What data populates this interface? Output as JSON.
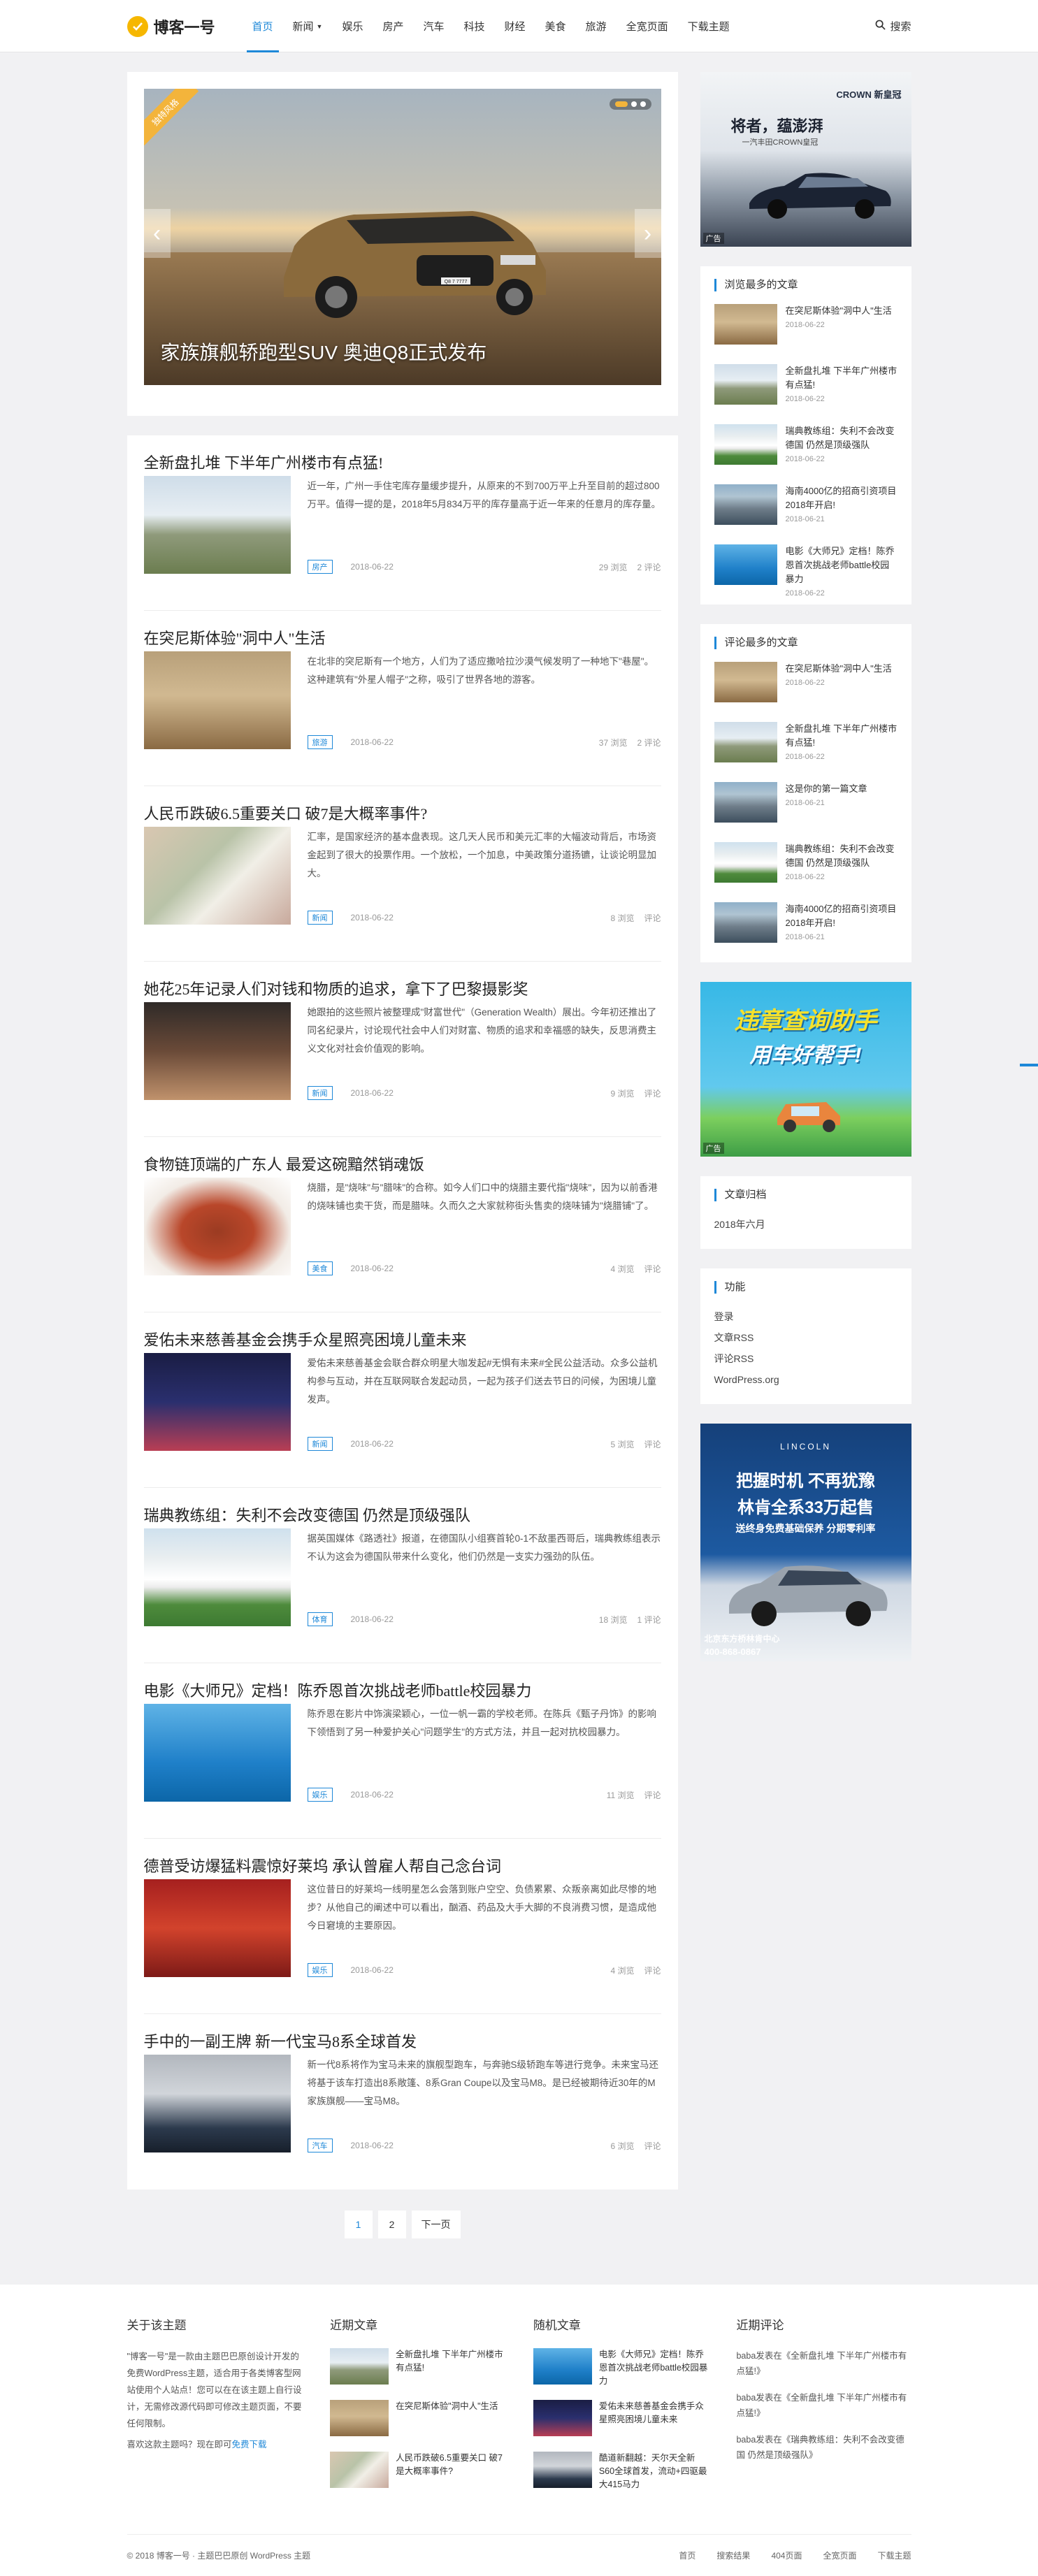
{
  "header": {
    "logo_text": "博客一号",
    "nav": [
      {
        "label": "首页",
        "active": true
      },
      {
        "label": "新闻",
        "dropdown": true
      },
      {
        "label": "娱乐"
      },
      {
        "label": "房产"
      },
      {
        "label": "汽车"
      },
      {
        "label": "科技"
      },
      {
        "label": "财经"
      },
      {
        "label": "美食"
      },
      {
        "label": "旅游"
      },
      {
        "label": "全宽页面"
      },
      {
        "label": "下载主题"
      }
    ],
    "search_label": "搜索"
  },
  "slider": {
    "badge": "独特风格",
    "title": "家族旗舰轿跑型SUV 奥迪Q8正式发布",
    "plate": "Q8 7 7777"
  },
  "posts": [
    {
      "title": "全新盘扎堆 下半年广州楼市有点猛!",
      "excerpt": "近一年，广州一手住宅库存量缓步提升，从原来的不到700万平上升至目前的超过800万平。值得一提的是，2018年5月834万平的库存量高于近一年来的任意月的库存量。",
      "tag": "房产",
      "date": "2018-06-22",
      "views": "29 浏览",
      "comments": "2 评论",
      "art": "art-a"
    },
    {
      "title": "在突尼斯体验\"洞中人\"生活",
      "excerpt": "在北非的突尼斯有一个地方，人们为了适应撒哈拉沙漠气候发明了一种地下\"巷屋\"。这种建筑有\"外星人帽子\"之称，吸引了世界各地的游客。",
      "tag": "旅游",
      "date": "2018-06-22",
      "views": "37 浏览",
      "comments": "2 评论",
      "art": "art-b"
    },
    {
      "title": "人民币跌破6.5重要关口 破7是大概率事件?",
      "excerpt": "汇率，是国家经济的基本盘表现。这几天人民币和美元汇率的大幅波动背后，市场资金起到了很大的投票作用。一个放松，一个加息，中美政策分道扬镳，让谈论明显加大。",
      "tag": "新闻",
      "date": "2018-06-22",
      "views": "8 浏览",
      "comments": "评论",
      "art": "art-c"
    },
    {
      "title": "她花25年记录人们对钱和物质的追求，拿下了巴黎摄影奖",
      "excerpt": "她跟拍的这些照片被整理成\"财富世代\"（Generation Wealth）展出。今年初还推出了同名纪录片，讨论现代社会中人们对财富、物质的追求和幸福感的缺失，反思消费主义文化对社会价值观的影响。",
      "tag": "新闻",
      "date": "2018-06-22",
      "views": "9 浏览",
      "comments": "评论",
      "art": "art-d"
    },
    {
      "title": "食物链顶端的广东人 最爱这碗黯然销魂饭",
      "excerpt": "烧腊，是\"烧味\"与\"腊味\"的合称。如今人们口中的烧腊主要代指\"烧味\"，因为以前香港的烧味铺也卖干货，而是腊味。久而久之大家就称街头售卖的烧味铺为\"烧腊铺\"了。",
      "tag": "美食",
      "date": "2018-06-22",
      "views": "4 浏览",
      "comments": "评论",
      "art": "art-e"
    },
    {
      "title": "爱佑未来慈善基金会携手众星照亮困境儿童未来",
      "excerpt": "爱佑未来慈善基金会联合群众明星大咖发起#无惧有未来#全民公益活动。众多公益机构参与互动，并在互联网联合发起动员，一起为孩子们送去节日的问候，为困境儿童发声。",
      "tag": "新闻",
      "date": "2018-06-22",
      "views": "5 浏览",
      "comments": "评论",
      "art": "art-f"
    },
    {
      "title": "瑞典教练组：失利不会改变德国 仍然是顶级强队",
      "excerpt": "据英国媒体《路透社》报道，在德国队小组赛首轮0-1不敌墨西哥后，瑞典教练组表示不认为这会为德国队带来什么变化，他们仍然是一支实力强劲的队伍。",
      "tag": "体育",
      "date": "2018-06-22",
      "views": "18 浏览",
      "comments": "1 评论",
      "art": "art-g"
    },
    {
      "title": "电影《大师兄》定档！陈乔恩首次挑战老师battle校园暴力",
      "excerpt": "陈乔恩在影片中饰演梁颖心，一位一帆一霸的学校老师。在陈兵《甄子丹饰》的影响下领悟到了另一种爱护关心\"问题学生\"的方式方法，并且一起对抗校园暴力。",
      "tag": "娱乐",
      "date": "2018-06-22",
      "views": "11 浏览",
      "comments": "评论",
      "art": "art-h"
    },
    {
      "title": "德普受访爆猛料震惊好莱坞 承认曾雇人帮自己念台词",
      "excerpt": "这位昔日的好莱坞一线明星怎么会落到账户空空、负债累累、众叛亲离如此尽惨的地步？从他自己的阐述中可以看出，酗酒、药品及大手大脚的不良消费习惯，是造成他今日窘境的主要原因。",
      "tag": "娱乐",
      "date": "2018-06-22",
      "views": "4 浏览",
      "comments": "评论",
      "art": "art-i"
    },
    {
      "title": "手中的一副王牌 新一代宝马8系全球首发",
      "excerpt": "新一代8系将作为宝马未来的旗舰型跑车，与奔驰S级轿跑车等进行竞争。未来宝马还将基于该车打造出8系敞篷、8系Gran Coupe以及宝马M8。是已经被期待近30年的M家族旗舰——宝马M8。",
      "tag": "汽车",
      "date": "2018-06-22",
      "views": "6 浏览",
      "comments": "评论",
      "art": "art-j"
    }
  ],
  "pager": {
    "p1": "1",
    "p2": "2",
    "next": "下一页"
  },
  "sidebar": {
    "ad1": {
      "brand": "CROWN 新皇冠",
      "slogan1": "将者，蕴澎湃",
      "slogan2": "一汽丰田CROWN皇冠",
      "label": "广告"
    },
    "most_viewed": {
      "title": "浏览最多的文章",
      "items": [
        {
          "title": "在突尼斯体验\"洞中人\"生活",
          "date": "2018-06-22",
          "art": "art-b"
        },
        {
          "title": "全新盘扎堆 下半年广州楼市有点猛!",
          "date": "2018-06-22",
          "art": "art-a"
        },
        {
          "title": "瑞典教练组：失利不会改变德国 仍然是顶级强队",
          "date": "2018-06-22",
          "art": "art-g"
        },
        {
          "title": "海南4000亿的招商引资项目2018年开启!",
          "date": "2018-06-21",
          "art": "art-k"
        },
        {
          "title": "电影《大师兄》定档！陈乔恩首次挑战老师battle校园暴力",
          "date": "2018-06-22",
          "art": "art-h"
        }
      ]
    },
    "most_commented": {
      "title": "评论最多的文章",
      "items": [
        {
          "title": "在突尼斯体验\"洞中人\"生活",
          "date": "2018-06-22",
          "art": "art-b"
        },
        {
          "title": "全新盘扎堆 下半年广州楼市有点猛!",
          "date": "2018-06-22",
          "art": "art-a"
        },
        {
          "title": "这是你的第一篇文章",
          "date": "2018-06-21",
          "art": "art-k"
        },
        {
          "title": "瑞典教练组：失利不会改变德国 仍然是顶级强队",
          "date": "2018-06-22",
          "art": "art-g"
        },
        {
          "title": "海南4000亿的招商引资项目2018年开启!",
          "date": "2018-06-21",
          "art": "art-k"
        }
      ]
    },
    "ad2": {
      "line1": "违章查询助手",
      "line2": "用车好帮手!",
      "label": "广告"
    },
    "archive": {
      "title": "文章归档",
      "items": [
        "2018年六月"
      ]
    },
    "meta": {
      "title": "功能",
      "items": [
        "登录",
        "文章RSS",
        "评论RSS",
        "WordPress.org"
      ]
    },
    "ad3": {
      "brand": "LINCOLN",
      "line1": "把握时机 不再犹豫",
      "line2": "林肯全系33万起售",
      "line3": "送终身免费基础保养 分期零利率",
      "dealer": "北京东方桥林肯中心",
      "phone": "400-868-0867"
    }
  },
  "footer": {
    "about_title": "关于该主题",
    "about_text": "\"博客一号\"是一款由主题巴巴原创设计开发的免费WordPress主题，适合用于各类博客型网站使用个人站点！您可以在在该主题上自行设计，无需修改源代码即可修改主题页面，不要任何限制。",
    "about_link_pre": "喜欢这款主题吗？现在即可",
    "about_link": "免费下载",
    "recent_title": "近期文章",
    "recent": [
      {
        "title": "全新盘扎堆 下半年广州楼市有点猛!",
        "art": "art-a"
      },
      {
        "title": "在突尼斯体验\"洞中人\"生活",
        "art": "art-b"
      },
      {
        "title": "人民币跌破6.5重要关口 破7是大概率事件?",
        "art": "art-c"
      }
    ],
    "random_title": "随机文章",
    "random": [
      {
        "title": "电影《大师兄》定档！陈乔恩首次挑战老师battle校园暴力",
        "art": "art-h"
      },
      {
        "title": "爱佑未来慈善基金会携手众星照亮困境儿童未来",
        "art": "art-f"
      },
      {
        "title": "酷道新翻越：天尔天全新S60全球首发，流动+四驱最大415马力",
        "art": "art-j"
      }
    ],
    "comments_title": "近期评论",
    "comments": [
      {
        "who": "baba发表在",
        "what": "《全新盘扎堆 下半年广州楼市有点猛!》"
      },
      {
        "who": "baba发表在",
        "what": "《全新盘扎堆 下半年广州楼市有点猛!》"
      },
      {
        "who": "baba发表在",
        "what": "《瑞典教练组：失利不会改变德国 仍然是顶级强队》"
      }
    ],
    "copyright": "© 2018 博客一号 · 主题巴巴原创 WordPress 主题",
    "links": [
      "首页",
      "搜索结果",
      "404页面",
      "全宽页面",
      "下载主题"
    ]
  }
}
